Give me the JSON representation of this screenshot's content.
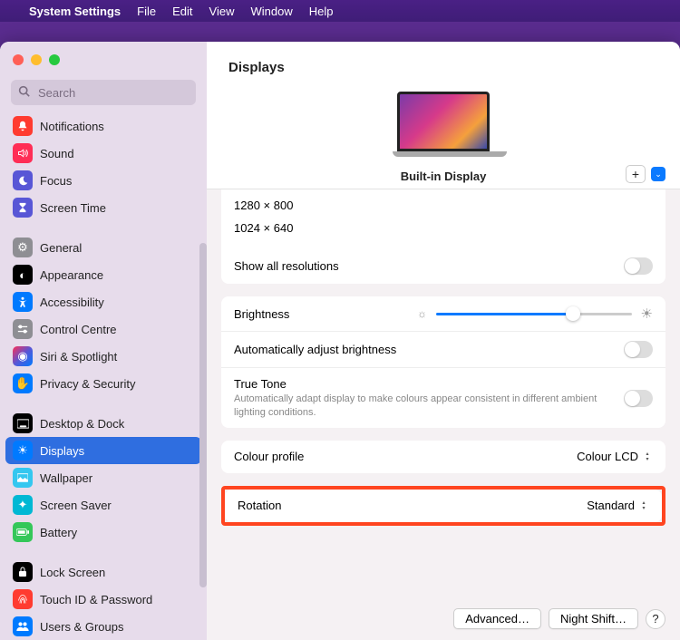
{
  "menubar": {
    "app": "System Settings",
    "items": [
      "File",
      "Edit",
      "View",
      "Window",
      "Help"
    ]
  },
  "sidebar": {
    "search_placeholder": "Search",
    "items": [
      {
        "label": "Notifications",
        "icon": "bell",
        "cls": "ic-notif"
      },
      {
        "label": "Sound",
        "icon": "speaker",
        "cls": "ic-sound"
      },
      {
        "label": "Focus",
        "icon": "moon",
        "cls": "ic-focus"
      },
      {
        "label": "Screen Time",
        "icon": "hourglass",
        "cls": "ic-screentime"
      }
    ],
    "items2": [
      {
        "label": "General",
        "icon": "gear",
        "cls": "ic-general"
      },
      {
        "label": "Appearance",
        "icon": "dial",
        "cls": "ic-appearance"
      },
      {
        "label": "Accessibility",
        "icon": "person",
        "cls": "ic-accessibility"
      },
      {
        "label": "Control Centre",
        "icon": "switches",
        "cls": "ic-control"
      },
      {
        "label": "Siri & Spotlight",
        "icon": "siri",
        "cls": "ic-siri"
      },
      {
        "label": "Privacy & Security",
        "icon": "hand",
        "cls": "ic-privacy"
      }
    ],
    "items3": [
      {
        "label": "Desktop & Dock",
        "icon": "dock",
        "cls": "ic-desktop"
      },
      {
        "label": "Displays",
        "icon": "sun",
        "cls": "ic-displays",
        "selected": true
      },
      {
        "label": "Wallpaper",
        "icon": "photo",
        "cls": "ic-wallpaper"
      },
      {
        "label": "Screen Saver",
        "icon": "sparkle",
        "cls": "ic-screensaver"
      },
      {
        "label": "Battery",
        "icon": "battery",
        "cls": "ic-battery"
      }
    ],
    "items4": [
      {
        "label": "Lock Screen",
        "icon": "lock",
        "cls": "ic-lock"
      },
      {
        "label": "Touch ID & Password",
        "icon": "fingerprint",
        "cls": "ic-touchid"
      },
      {
        "label": "Users & Groups",
        "icon": "users",
        "cls": "ic-users"
      }
    ]
  },
  "displays": {
    "title": "Displays",
    "current": "Built-in Display",
    "resolutions": [
      "1280 × 800",
      "1024 × 640"
    ],
    "show_all": "Show all resolutions",
    "brightness": "Brightness",
    "auto_brightness": "Automatically adjust brightness",
    "true_tone": "True Tone",
    "true_tone_desc": "Automatically adapt display to make colours appear consistent in different ambient lighting conditions.",
    "colour_profile": "Colour profile",
    "colour_profile_val": "Colour LCD",
    "rotation": "Rotation",
    "rotation_val": "Standard",
    "advanced": "Advanced…",
    "night_shift": "Night Shift…"
  }
}
